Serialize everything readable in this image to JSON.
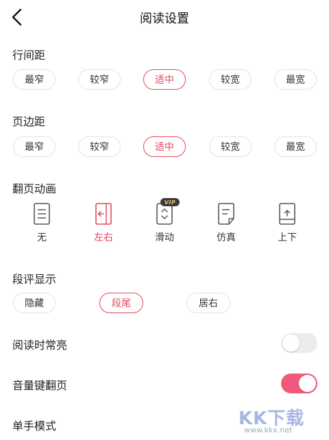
{
  "header": {
    "title": "阅读设置",
    "back_icon": "back-arrow-icon"
  },
  "line_spacing": {
    "title": "行间距",
    "options": [
      "最窄",
      "较窄",
      "适中",
      "较宽",
      "最宽"
    ],
    "selected": "适中"
  },
  "margin": {
    "title": "页边距",
    "options": [
      "最窄",
      "较窄",
      "适中",
      "较宽",
      "最宽"
    ],
    "selected": "适中"
  },
  "page_turn": {
    "title": "翻页动画",
    "options": [
      {
        "label": "无",
        "icon": "page-lines-icon"
      },
      {
        "label": "左右",
        "icon": "page-arrow-left-icon"
      },
      {
        "label": "滑动",
        "icon": "page-updown-icon",
        "badge": "VIP"
      },
      {
        "label": "仿真",
        "icon": "page-curl-icon"
      },
      {
        "label": "上下",
        "icon": "page-arrow-up-icon"
      }
    ],
    "selected": "左右"
  },
  "comment_display": {
    "title": "段评显示",
    "options": [
      "隐藏",
      "段尾",
      "居右"
    ],
    "selected": "段尾"
  },
  "toggles": [
    {
      "label": "阅读时常亮",
      "on": false
    },
    {
      "label": "音量键翻页",
      "on": true
    }
  ],
  "one_hand": {
    "label": "单手模式"
  },
  "colors": {
    "accent": "#e2455b",
    "toggle_on": "#f0597a",
    "toggle_off": "#ececec"
  },
  "watermark": {
    "text": "KK下载",
    "url": "www.kkx.net"
  }
}
